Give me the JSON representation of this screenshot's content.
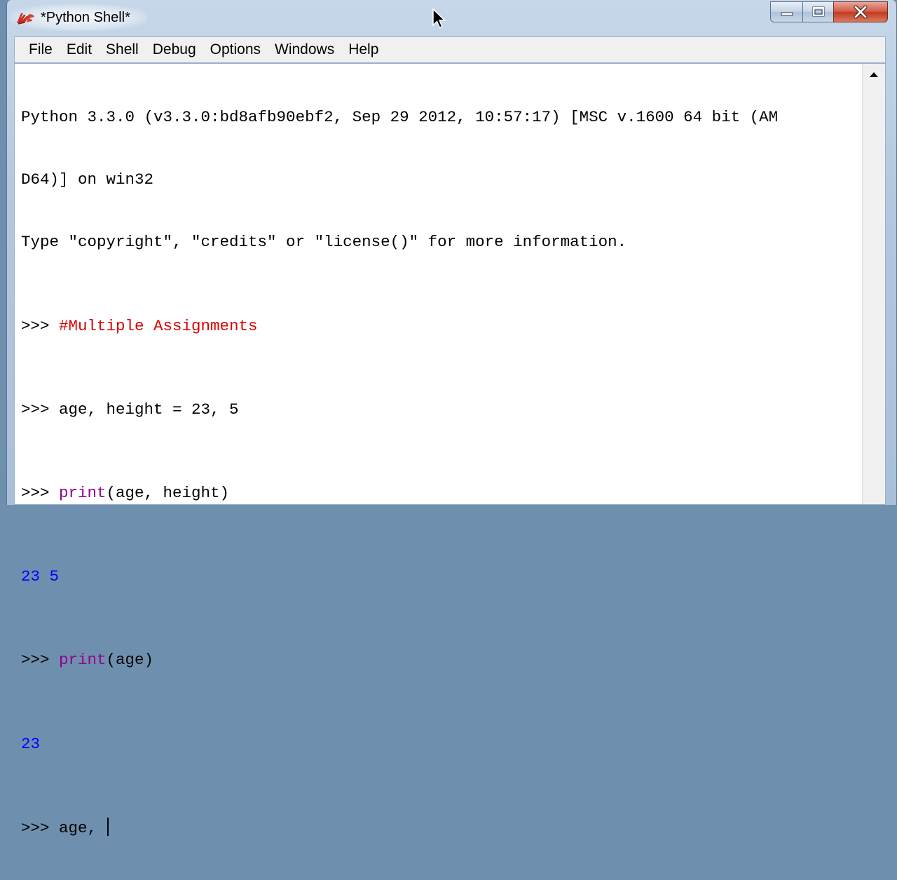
{
  "window": {
    "title": "*Python Shell*",
    "app_icon": "idle-feather-icon"
  },
  "caption_buttons": {
    "minimize_icon": "minimize-icon",
    "maximize_icon": "maximize-icon",
    "close_icon": "close-icon"
  },
  "menu": {
    "items": [
      {
        "label": "File"
      },
      {
        "label": "Edit"
      },
      {
        "label": "Shell"
      },
      {
        "label": "Debug"
      },
      {
        "label": "Options"
      },
      {
        "label": "Windows"
      },
      {
        "label": "Help"
      }
    ]
  },
  "shell": {
    "header_line_1": "Python 3.3.0 (v3.3.0:bd8afb90ebf2, Sep 29 2012, 10:57:17) [MSC v.1600 64 bit (AM",
    "header_line_2": "D64)] on win32",
    "header_line_3": "Type \"copyright\", \"credits\" or \"license()\" for more information.",
    "prompt": ">>> ",
    "lines": [
      {
        "comment": "#Multiple Assignments"
      },
      {
        "code": "age, height = 23, 5"
      },
      {
        "builtin": "print",
        "rest": "(age, height)"
      },
      {
        "output": "23 5"
      },
      {
        "builtin": "print",
        "rest": "(age)"
      },
      {
        "output": "23"
      },
      {
        "code": "age, "
      }
    ]
  },
  "colors": {
    "comment": "#dd0000",
    "builtin": "#900090",
    "output": "#0000ff",
    "close_button": "#c23a20"
  }
}
